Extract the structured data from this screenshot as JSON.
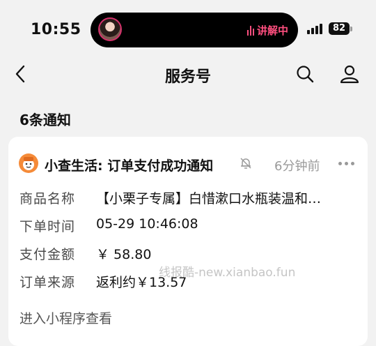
{
  "status_bar": {
    "time": "10:55",
    "live_label": "讲解中",
    "battery": "82"
  },
  "nav": {
    "title": "服务号"
  },
  "notifications": {
    "count_label": "6条通知"
  },
  "card": {
    "title": "小查生活: 订单支付成功通知",
    "time_ago": "6分钟前",
    "fields": [
      {
        "label": "商品名称",
        "value": "【小栗子专属】白惜漱口水瓶装温和…"
      },
      {
        "label": "下单时间",
        "value": "05-29 10:46:08"
      },
      {
        "label": "支付金额",
        "value": "￥ 58.80"
      },
      {
        "label": "订单来源",
        "value": "返利约￥13.57"
      }
    ],
    "link": "进入小程序查看"
  },
  "watermark": "线报酷-new.xianbao.fun",
  "colors": {
    "live_accent": "#ff4f7f",
    "app_avatar": "#f58b39",
    "background": "#f2f2f2"
  }
}
